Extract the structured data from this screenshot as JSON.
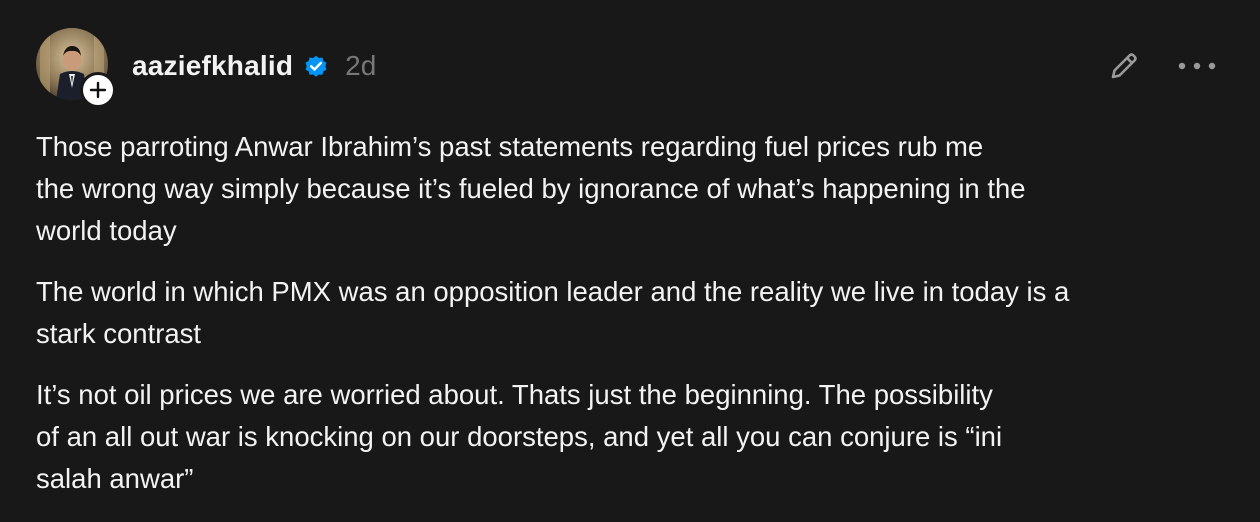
{
  "post": {
    "author": {
      "username": "aaziefkhalid",
      "verified": true,
      "avatar_icon": "profile-photo"
    },
    "timestamp": "2d",
    "paragraphs": [
      "Those parroting Anwar Ibrahim’s past statements regarding fuel prices rub me\nthe wrong way simply because it’s fueled by ignorance of what’s happening in the\nworld today",
      "The world in which PMX was an opposition leader and the reality we live in today is a\nstark contrast",
      "It’s not oil prices we are worried about. Thats just the beginning. The possibility\nof an all out war is knocking on our doorsteps, and yet all you can conjure is “ini\nsalah anwar”"
    ],
    "actions": {
      "edit_icon": "pencil-icon",
      "more_icon": "more-horizontal-icon",
      "follow_icon": "plus-icon"
    }
  },
  "colors": {
    "background": "#181818",
    "text": "#f3f3f3",
    "muted": "#777777",
    "verified_blue": "#0095f6"
  }
}
